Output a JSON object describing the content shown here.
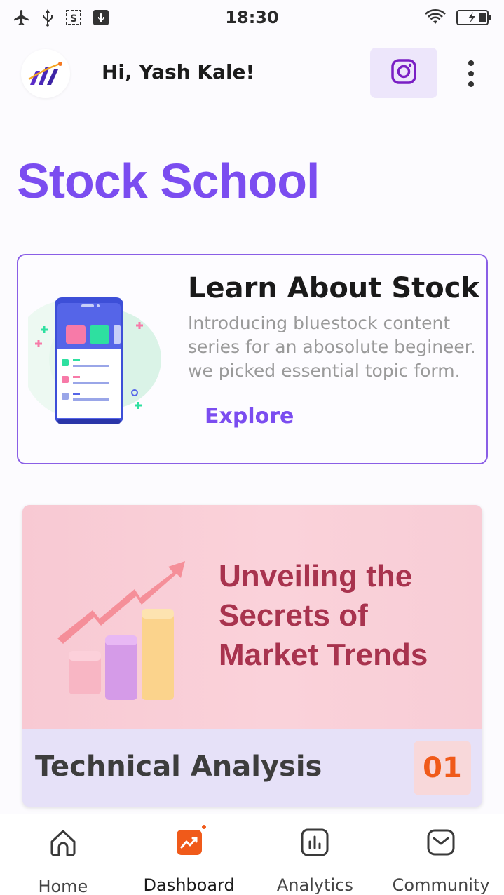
{
  "status_bar": {
    "time": "18:30",
    "icons_left": [
      "airplane-icon",
      "usb-icon",
      "screenshot-icon",
      "usb-settings-icon"
    ],
    "icons_right": [
      "wifi-icon",
      "battery-charging-icon"
    ]
  },
  "header": {
    "greeting": "Hi, Yash Kale!",
    "logo_icon": "app-logo-icon",
    "instagram_icon": "instagram-icon",
    "more_icon": "more-vertical-icon"
  },
  "page": {
    "title": "Stock School"
  },
  "learn_card": {
    "title": "Learn About Stock",
    "description": "Introducing bluestock content series for an abosolute begineer. we picked essential topic form.",
    "cta": "Explore"
  },
  "course_card": {
    "banner_text": "Unveiling the Secrets of Market Trends",
    "name": "Technical Analysis",
    "number": "01"
  },
  "bottom_nav": {
    "items": [
      {
        "label": "Home",
        "icon": "home-icon"
      },
      {
        "label": "Dashboard",
        "icon": "dashboard-icon"
      },
      {
        "label": "Analytics",
        "icon": "analytics-icon"
      },
      {
        "label": "Community",
        "icon": "mail-icon"
      }
    ],
    "active_index": 1
  },
  "colors": {
    "accent": "#7b4df0",
    "dashboard_orange": "#f05a1a",
    "banner_text": "#a8334e"
  }
}
